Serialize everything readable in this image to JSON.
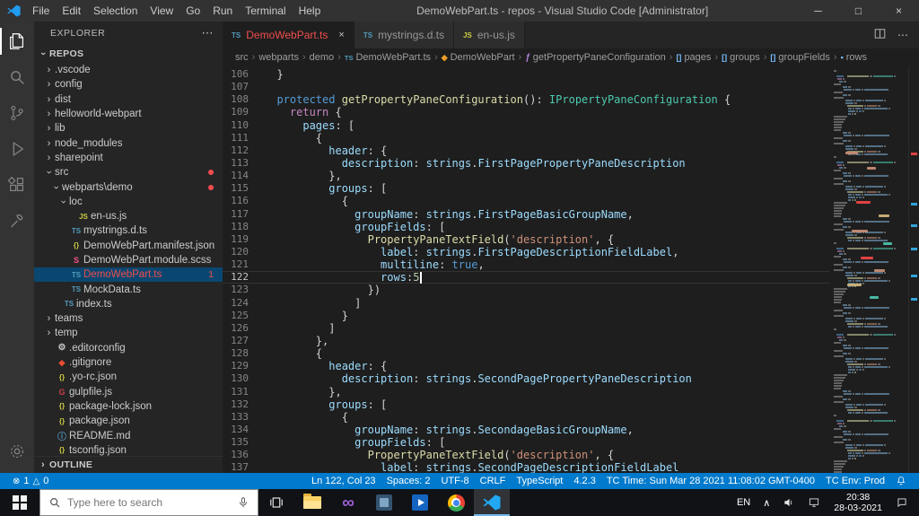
{
  "window": {
    "title": "DemoWebPart.ts - repos - Visual Studio Code [Administrator]",
    "menus": [
      "File",
      "Edit",
      "Selection",
      "View",
      "Go",
      "Run",
      "Terminal",
      "Help"
    ],
    "controls": {
      "minimize": "─",
      "maximize": "□",
      "close": "×"
    }
  },
  "activity_bar": [
    {
      "id": "explorer",
      "active": true
    },
    {
      "id": "search"
    },
    {
      "id": "source-control"
    },
    {
      "id": "run-debug"
    },
    {
      "id": "extensions"
    },
    {
      "id": "tools"
    },
    {
      "id": "settings",
      "bottom": true
    }
  ],
  "sidebar": {
    "title": "EXPLORER",
    "actions": "⋯",
    "section": "REPOS",
    "outline": "OUTLINE",
    "items": [
      {
        "label": ".vscode",
        "indent": 1,
        "chevron": "right"
      },
      {
        "label": "config",
        "indent": 1,
        "chevron": "right"
      },
      {
        "label": "dist",
        "indent": 1,
        "chevron": "right"
      },
      {
        "label": "helloworld-webpart",
        "indent": 1,
        "chevron": "right"
      },
      {
        "label": "lib",
        "indent": 1,
        "chevron": "right"
      },
      {
        "label": "node_modules",
        "indent": 1,
        "chevron": "right"
      },
      {
        "label": "sharepoint",
        "indent": 1,
        "chevron": "right"
      },
      {
        "label": "src",
        "indent": 1,
        "chevron": "down",
        "dot": true
      },
      {
        "label": "webparts\\demo",
        "indent": 2,
        "chevron": "down",
        "dot": true
      },
      {
        "label": "loc",
        "indent": 3,
        "chevron": "down"
      },
      {
        "label": "en-us.js",
        "indent": 4,
        "icon": "js"
      },
      {
        "label": "mystrings.d.ts",
        "indent": 3,
        "icon": "ts"
      },
      {
        "label": "DemoWebPart.manifest.json",
        "indent": 3,
        "icon": "json"
      },
      {
        "label": "DemoWebPart.module.scss",
        "indent": 3,
        "icon": "scss"
      },
      {
        "label": "DemoWebPart.ts",
        "indent": 3,
        "icon": "ts",
        "selected": true,
        "error": true,
        "badge": "1"
      },
      {
        "label": "MockData.ts",
        "indent": 3,
        "icon": "ts"
      },
      {
        "label": "index.ts",
        "indent": 2,
        "icon": "ts"
      },
      {
        "label": "teams",
        "indent": 1,
        "chevron": "right"
      },
      {
        "label": "temp",
        "indent": 1,
        "chevron": "right"
      },
      {
        "label": ".editorconfig",
        "indent": 1,
        "icon": "gear"
      },
      {
        "label": ".gitignore",
        "indent": 1,
        "icon": "git"
      },
      {
        "label": ".yo-rc.json",
        "indent": 1,
        "icon": "json"
      },
      {
        "label": "gulpfile.js",
        "indent": 1,
        "icon": "gulp"
      },
      {
        "label": "package-lock.json",
        "indent": 1,
        "icon": "json"
      },
      {
        "label": "package.json",
        "indent": 1,
        "icon": "json"
      },
      {
        "label": "README.md",
        "indent": 1,
        "icon": "info"
      },
      {
        "label": "tsconfig.json",
        "indent": 1,
        "icon": "json"
      }
    ]
  },
  "tabs": [
    {
      "label": "DemoWebPart.ts",
      "icon": "ts",
      "active": true,
      "error": true,
      "close": "×"
    },
    {
      "label": "mystrings.d.ts",
      "icon": "ts"
    },
    {
      "label": "en-us.js",
      "icon": "js"
    }
  ],
  "breadcrumbs": [
    {
      "label": "src"
    },
    {
      "label": "webparts"
    },
    {
      "label": "demo"
    },
    {
      "label": "DemoWebPart.ts",
      "icon": "ts",
      "glyph": "TS"
    },
    {
      "label": "DemoWebPart",
      "icon": "class",
      "glyph": "◆"
    },
    {
      "label": "getPropertyPaneConfiguration",
      "icon": "method",
      "glyph": "ƒ"
    },
    {
      "label": "pages",
      "icon": "array",
      "glyph": "[]"
    },
    {
      "label": "groups",
      "icon": "array",
      "glyph": "[]"
    },
    {
      "label": "groupFields",
      "icon": "array",
      "glyph": "[]"
    },
    {
      "label": "rows",
      "icon": "prop",
      "glyph": "▪"
    }
  ],
  "editor": {
    "current_line": 122,
    "lines": [
      {
        "n": 106,
        "t": [
          [
            "  }",
            "pln"
          ]
        ]
      },
      {
        "n": 107,
        "t": []
      },
      {
        "n": 108,
        "t": [
          [
            "  ",
            "pln"
          ],
          [
            "protected",
            "kw"
          ],
          [
            " ",
            "pln"
          ],
          [
            "getPropertyPaneConfiguration",
            "fn"
          ],
          [
            "(): ",
            "pln"
          ],
          [
            "IPropertyPaneConfiguration",
            "typ"
          ],
          [
            " {",
            "pln"
          ]
        ]
      },
      {
        "n": 109,
        "t": [
          [
            "    ",
            "pln"
          ],
          [
            "return",
            "ctl"
          ],
          [
            " {",
            "pln"
          ]
        ]
      },
      {
        "n": 110,
        "t": [
          [
            "      ",
            "pln"
          ],
          [
            "pages",
            "prop"
          ],
          [
            ": [",
            "pln"
          ]
        ]
      },
      {
        "n": 111,
        "t": [
          [
            "        {",
            "pln"
          ]
        ]
      },
      {
        "n": 112,
        "t": [
          [
            "          ",
            "pln"
          ],
          [
            "header",
            "prop"
          ],
          [
            ": {",
            "pln"
          ]
        ]
      },
      {
        "n": 113,
        "t": [
          [
            "            ",
            "pln"
          ],
          [
            "description",
            "prop"
          ],
          [
            ": ",
            "pln"
          ],
          [
            "strings",
            "prop"
          ],
          [
            ".",
            "pln"
          ],
          [
            "FirstPagePropertyPaneDescription",
            "prop"
          ]
        ]
      },
      {
        "n": 114,
        "t": [
          [
            "          },",
            "pln"
          ]
        ]
      },
      {
        "n": 115,
        "t": [
          [
            "          ",
            "pln"
          ],
          [
            "groups",
            "prop"
          ],
          [
            ": [",
            "pln"
          ]
        ]
      },
      {
        "n": 116,
        "t": [
          [
            "            {",
            "pln"
          ]
        ]
      },
      {
        "n": 117,
        "t": [
          [
            "              ",
            "pln"
          ],
          [
            "groupName",
            "prop"
          ],
          [
            ": ",
            "pln"
          ],
          [
            "strings",
            "prop"
          ],
          [
            ".",
            "pln"
          ],
          [
            "FirstPageBasicGroupName",
            "prop"
          ],
          [
            ",",
            "pln"
          ]
        ]
      },
      {
        "n": 118,
        "t": [
          [
            "              ",
            "pln"
          ],
          [
            "groupFields",
            "prop"
          ],
          [
            ": [",
            "pln"
          ]
        ]
      },
      {
        "n": 119,
        "t": [
          [
            "                ",
            "pln"
          ],
          [
            "PropertyPaneTextField",
            "fn"
          ],
          [
            "(",
            "pln"
          ],
          [
            "'description'",
            "str"
          ],
          [
            ", {",
            "pln"
          ]
        ]
      },
      {
        "n": 120,
        "t": [
          [
            "                  ",
            "pln"
          ],
          [
            "label",
            "prop"
          ],
          [
            ": ",
            "pln"
          ],
          [
            "strings",
            "prop"
          ],
          [
            ".",
            "pln"
          ],
          [
            "FirstPageDescriptionFieldLabel",
            "prop"
          ],
          [
            ",",
            "pln"
          ]
        ]
      },
      {
        "n": 121,
        "t": [
          [
            "                  ",
            "pln"
          ],
          [
            "multiline",
            "prop"
          ],
          [
            ": ",
            "pln"
          ],
          [
            "true",
            "kw"
          ],
          [
            ",",
            "pln"
          ]
        ]
      },
      {
        "n": 122,
        "t": [
          [
            "                  ",
            "pln"
          ],
          [
            "rows",
            "prop"
          ],
          [
            ":",
            "pln"
          ],
          [
            "5",
            "num"
          ]
        ]
      },
      {
        "n": 123,
        "t": [
          [
            "                })",
            "pln"
          ]
        ]
      },
      {
        "n": 124,
        "t": [
          [
            "              ]",
            "pln"
          ]
        ]
      },
      {
        "n": 125,
        "t": [
          [
            "            }",
            "pln"
          ]
        ]
      },
      {
        "n": 126,
        "t": [
          [
            "          ]",
            "pln"
          ]
        ]
      },
      {
        "n": 127,
        "t": [
          [
            "        },",
            "pln"
          ]
        ]
      },
      {
        "n": 128,
        "t": [
          [
            "        {",
            "pln"
          ]
        ]
      },
      {
        "n": 129,
        "t": [
          [
            "          ",
            "pln"
          ],
          [
            "header",
            "prop"
          ],
          [
            ": {",
            "pln"
          ]
        ]
      },
      {
        "n": 130,
        "t": [
          [
            "            ",
            "pln"
          ],
          [
            "description",
            "prop"
          ],
          [
            ": ",
            "pln"
          ],
          [
            "strings",
            "prop"
          ],
          [
            ".",
            "pln"
          ],
          [
            "SecondPagePropertyPaneDescription",
            "prop"
          ]
        ]
      },
      {
        "n": 131,
        "t": [
          [
            "          },",
            "pln"
          ]
        ]
      },
      {
        "n": 132,
        "t": [
          [
            "          ",
            "pln"
          ],
          [
            "groups",
            "prop"
          ],
          [
            ": [",
            "pln"
          ]
        ]
      },
      {
        "n": 133,
        "t": [
          [
            "            {",
            "pln"
          ]
        ]
      },
      {
        "n": 134,
        "t": [
          [
            "              ",
            "pln"
          ],
          [
            "groupName",
            "prop"
          ],
          [
            ": ",
            "pln"
          ],
          [
            "strings",
            "prop"
          ],
          [
            ".",
            "pln"
          ],
          [
            "SecondageBasicGroupName",
            "prop"
          ],
          [
            ",",
            "pln"
          ]
        ]
      },
      {
        "n": 135,
        "t": [
          [
            "              ",
            "pln"
          ],
          [
            "groupFields",
            "prop"
          ],
          [
            ": [",
            "pln"
          ]
        ]
      },
      {
        "n": 136,
        "t": [
          [
            "                ",
            "pln"
          ],
          [
            "PropertyPaneTextField",
            "fn"
          ],
          [
            "(",
            "pln"
          ],
          [
            "'description'",
            "str"
          ],
          [
            ", {",
            "pln"
          ]
        ]
      },
      {
        "n": 137,
        "t": [
          [
            "                  ",
            "pln"
          ],
          [
            "label",
            "prop"
          ],
          [
            ": ",
            "pln"
          ],
          [
            "strings",
            "prop"
          ],
          [
            ".",
            "pln"
          ],
          [
            "SecondPageDescriptionFieldLabel",
            "prop"
          ]
        ]
      }
    ]
  },
  "minimap": {
    "marks": [
      {
        "t": 95,
        "l": 18,
        "w": 14,
        "c": "#ce9178"
      },
      {
        "t": 112,
        "l": 42,
        "w": 10,
        "c": "#ce9178"
      },
      {
        "t": 150,
        "l": 30,
        "w": 16,
        "c": "#f44747"
      },
      {
        "t": 165,
        "l": 55,
        "w": 12,
        "c": "#d7ba7d"
      },
      {
        "t": 182,
        "l": 25,
        "w": 18,
        "c": "#ce9178"
      },
      {
        "t": 196,
        "l": 60,
        "w": 10,
        "c": "#4ec9b0"
      },
      {
        "t": 212,
        "l": 35,
        "w": 14,
        "c": "#f44747"
      },
      {
        "t": 226,
        "l": 50,
        "w": 12,
        "c": "#ce9178"
      },
      {
        "t": 242,
        "l": 20,
        "w": 16,
        "c": "#d7ba7d"
      },
      {
        "t": 256,
        "l": 45,
        "w": 10,
        "c": "#4ec9b0"
      }
    ],
    "ruler": [
      {
        "t": 96,
        "c": "#f44747"
      },
      {
        "t": 152,
        "c": "#35b1f1"
      },
      {
        "t": 176,
        "c": "#35b1f1"
      },
      {
        "t": 202,
        "c": "#35b1f1"
      },
      {
        "t": 232,
        "c": "#35b1f1"
      },
      {
        "t": 258,
        "c": "#35b1f1"
      }
    ]
  },
  "status_bar": {
    "errors": "1",
    "warnings": "0",
    "error_glyph": "⊗",
    "warning_glyph": "△",
    "items": [
      "Ln 122, Col 23",
      "Spaces: 2",
      "UTF-8",
      "CRLF",
      "TypeScript",
      "4.2.3",
      "TC Time: Sun Mar 28 2021 11:08:02 GMT-0400",
      "TC Env: Prod"
    ]
  },
  "taskbar": {
    "search_placeholder": "Type here to search",
    "apps": [
      {
        "id": "file-explorer"
      },
      {
        "id": "visual-studio",
        "glyph": "∞"
      },
      {
        "id": "app-blue"
      },
      {
        "id": "app-media"
      },
      {
        "id": "chrome"
      },
      {
        "id": "vscode",
        "active": true
      }
    ],
    "tray": {
      "lang": "EN",
      "chevron": "∧",
      "time": "20:38",
      "date": "28-03-2021"
    }
  }
}
